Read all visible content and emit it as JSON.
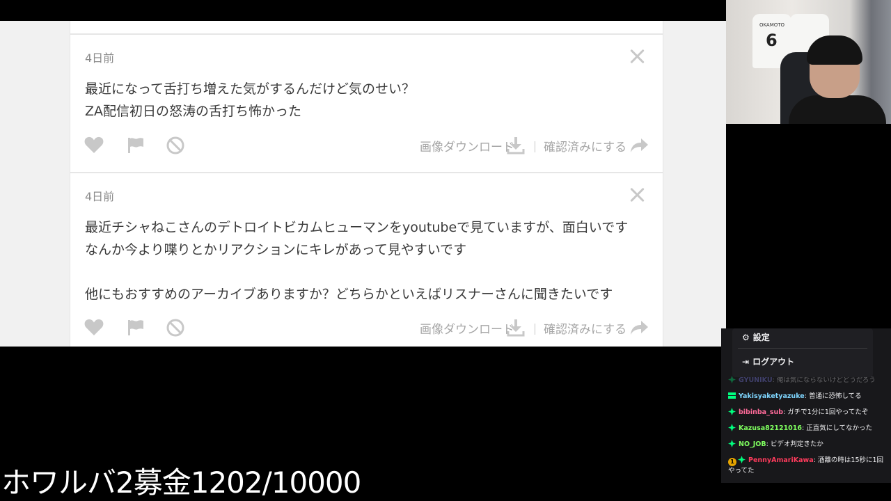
{
  "comments": [
    {
      "time": "4日前",
      "lines": [
        "最近になって舌打ち増えた気がするんだけど気のせい？",
        "ZA配信初日の怒涛の舌打ち怖かった"
      ],
      "download_label": "画像ダウンロード",
      "confirm_label": "確認済みにする"
    },
    {
      "time": "4日前",
      "lines": [
        "最近チシャねこさんのデトロイトビカムヒューマンをyoutubeで見ていますが、面白いです",
        "なんか今より喋りとかリアクションにキレがあって見やすいです",
        "",
        "他にもおすすめのアーカイブありますか？どちらかといえばリスナーさんに聞きたいです"
      ],
      "download_label": "画像ダウンロード",
      "confirm_label": "確認済みにする"
    }
  ],
  "icons": {
    "like": "heart-icon",
    "report": "flag-icon",
    "block": "ban-icon",
    "close": "close-icon",
    "download": "download-icon",
    "confirm": "share-arrow-icon"
  },
  "colors": {
    "icon_gray": "#c8c8c8",
    "text_gray": "#a6a6a6",
    "chat_green": "#00ff7f"
  },
  "webcam": {
    "jersey_name": "OKAMOTO",
    "jersey_number": "6"
  },
  "menu": {
    "settings_label": "設定",
    "logout_label": "ログアウト"
  },
  "chat": {
    "messages": [
      {
        "user": "GYUNIKU",
        "text": "俺は気にならないけどどうだろう",
        "color": "#8a8aff"
      },
      {
        "user": "Yakisyaketyazuke",
        "text": "普通に恐怖してる",
        "color": "#7fd6ff"
      },
      {
        "user": "bibinba_sub",
        "text": "ガチで1分に1回やってたぞ",
        "color": "#ff6b9a"
      },
      {
        "user": "Kazusa82121016",
        "text": "正直気にしてなかった",
        "color": "#7fff5f"
      },
      {
        "user": "NO_JOB",
        "text": "ビデオ判定きたか",
        "color": "#7fff5f"
      },
      {
        "user": "PennyAmariKawa",
        "text": "酒離の時は15秒に1回やってた",
        "color": "#ff3b5c",
        "sub_badge": "1"
      }
    ]
  },
  "caption": "ホワルバ2募金1202/10000"
}
